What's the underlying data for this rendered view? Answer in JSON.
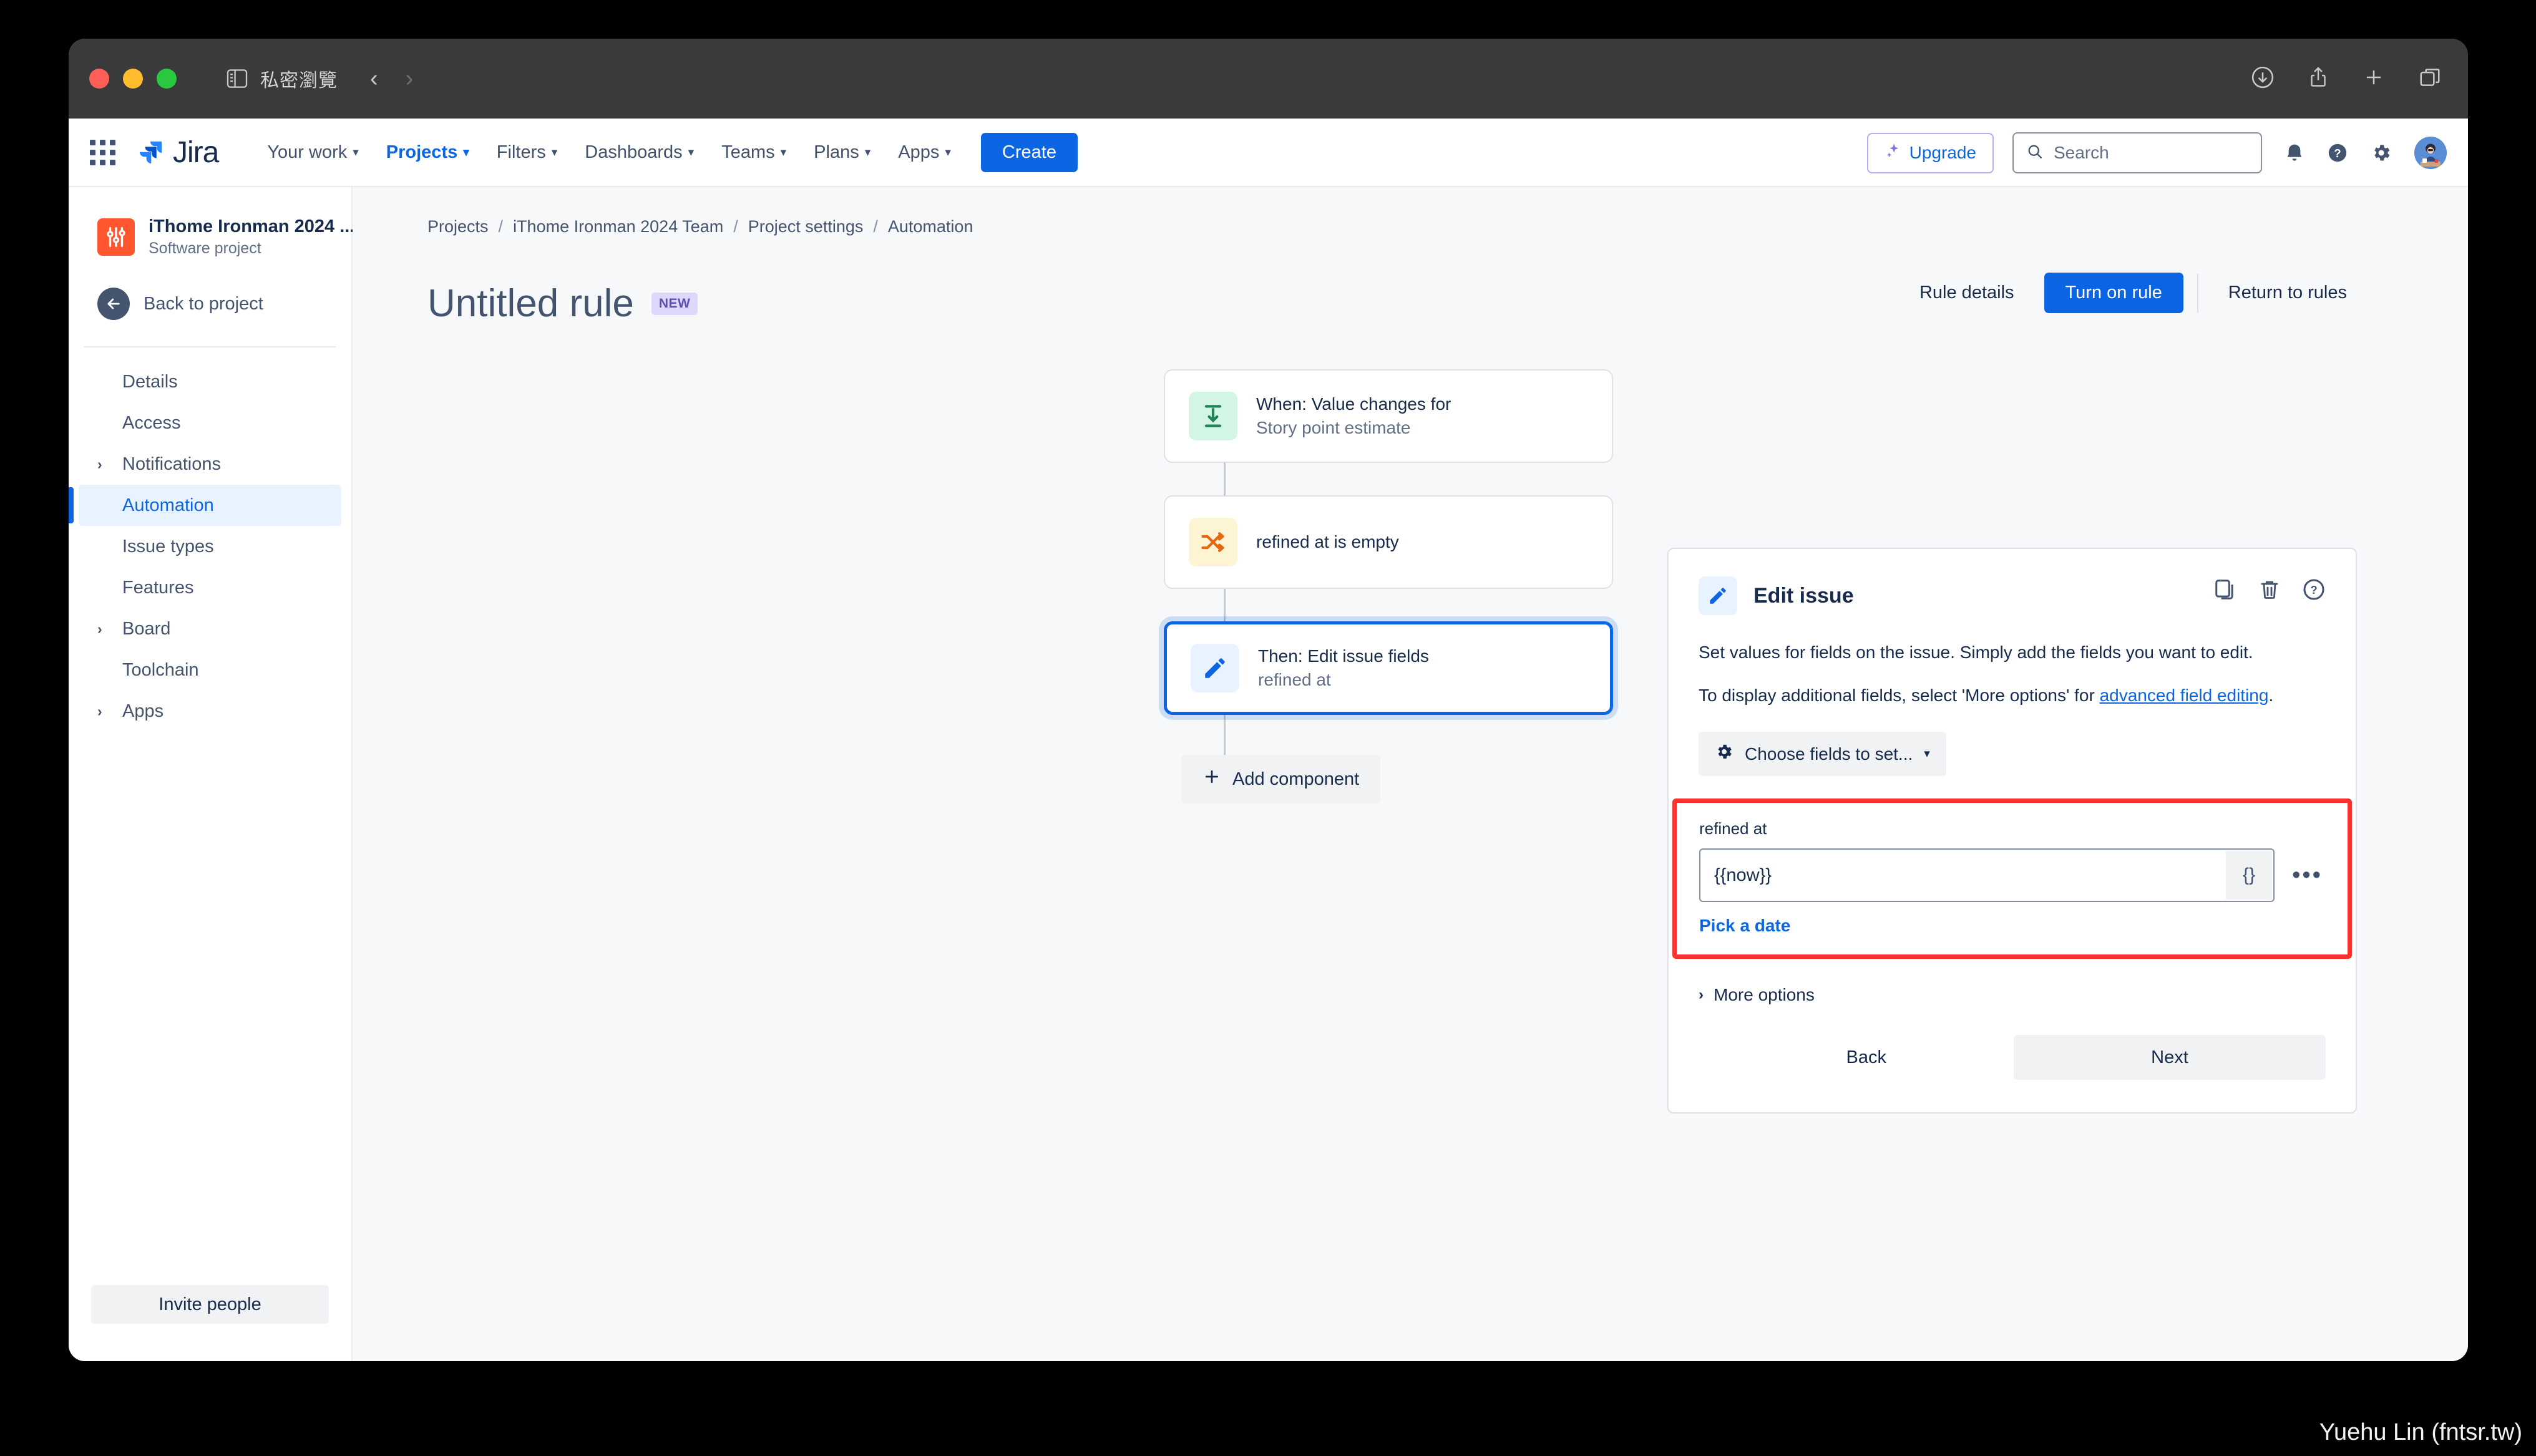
{
  "browser": {
    "private_label": "私密瀏覽",
    "back_arrow": "‹",
    "forward_arrow": "›",
    "icons": {
      "sidebar": "sidebar-toggle-icon",
      "download": "download-icon",
      "share": "share-icon",
      "new_tab": "plus-icon",
      "tab_overview": "tab-overview-icon"
    }
  },
  "topnav": {
    "logo_text": "Jira",
    "items": [
      {
        "label": "Your work",
        "has_caret": true,
        "active": false
      },
      {
        "label": "Projects",
        "has_caret": true,
        "active": true
      },
      {
        "label": "Filters",
        "has_caret": true,
        "active": false
      },
      {
        "label": "Dashboards",
        "has_caret": true,
        "active": false
      },
      {
        "label": "Teams",
        "has_caret": true,
        "active": false
      },
      {
        "label": "Plans",
        "has_caret": true,
        "active": false
      },
      {
        "label": "Apps",
        "has_caret": true,
        "active": false
      }
    ],
    "create_label": "Create",
    "upgrade_label": "Upgrade",
    "search_placeholder": "Search",
    "search_value": ""
  },
  "sidebar": {
    "project_name": "iThome Ironman 2024 ...",
    "project_type": "Software project",
    "back_label": "Back to project",
    "items": [
      {
        "label": "Details",
        "expandable": false,
        "active": false
      },
      {
        "label": "Access",
        "expandable": false,
        "active": false
      },
      {
        "label": "Notifications",
        "expandable": true,
        "active": false
      },
      {
        "label": "Automation",
        "expandable": false,
        "active": true
      },
      {
        "label": "Issue types",
        "expandable": false,
        "active": false
      },
      {
        "label": "Features",
        "expandable": false,
        "active": false
      },
      {
        "label": "Board",
        "expandable": true,
        "active": false
      },
      {
        "label": "Toolchain",
        "expandable": false,
        "active": false
      },
      {
        "label": "Apps",
        "expandable": true,
        "active": false
      }
    ],
    "invite_label": "Invite people"
  },
  "breadcrumb": [
    "Projects",
    "iThome Ironman 2024 Team",
    "Project settings",
    "Automation"
  ],
  "header": {
    "rule_title": "Untitled rule",
    "badge": "NEW",
    "rule_details_label": "Rule details",
    "turn_on_label": "Turn on rule",
    "return_label": "Return to rules"
  },
  "canvas": {
    "nodes": [
      {
        "title": "When: Value changes for",
        "subtitle": "Story point estimate",
        "icon": "trigger-icon",
        "selected": false
      },
      {
        "title": "refined at is empty",
        "subtitle": "",
        "icon": "condition-icon",
        "selected": false
      },
      {
        "title": "Then: Edit issue fields",
        "subtitle": "refined at",
        "icon": "action-edit-icon",
        "selected": true
      }
    ],
    "add_component_label": "Add component"
  },
  "panel": {
    "title": "Edit issue",
    "description_1": "Set values for fields on the issue. Simply add the fields you want to edit.",
    "description_2_before": "To display additional fields, select 'More options' for ",
    "description_2_link": "advanced field editing",
    "description_2_after": ".",
    "choose_fields_label": "Choose fields to set...",
    "field": {
      "label": "refined at",
      "value": "{{now}}",
      "smart_value_btn": "{}",
      "overflow_btn": "•••",
      "pick_date_label": "Pick a date"
    },
    "more_options_label": "More options",
    "back_label": "Back",
    "next_label": "Next",
    "highlight_color": "#f6332e"
  },
  "watermark": "Yuehu Lin (fntsr.tw)"
}
